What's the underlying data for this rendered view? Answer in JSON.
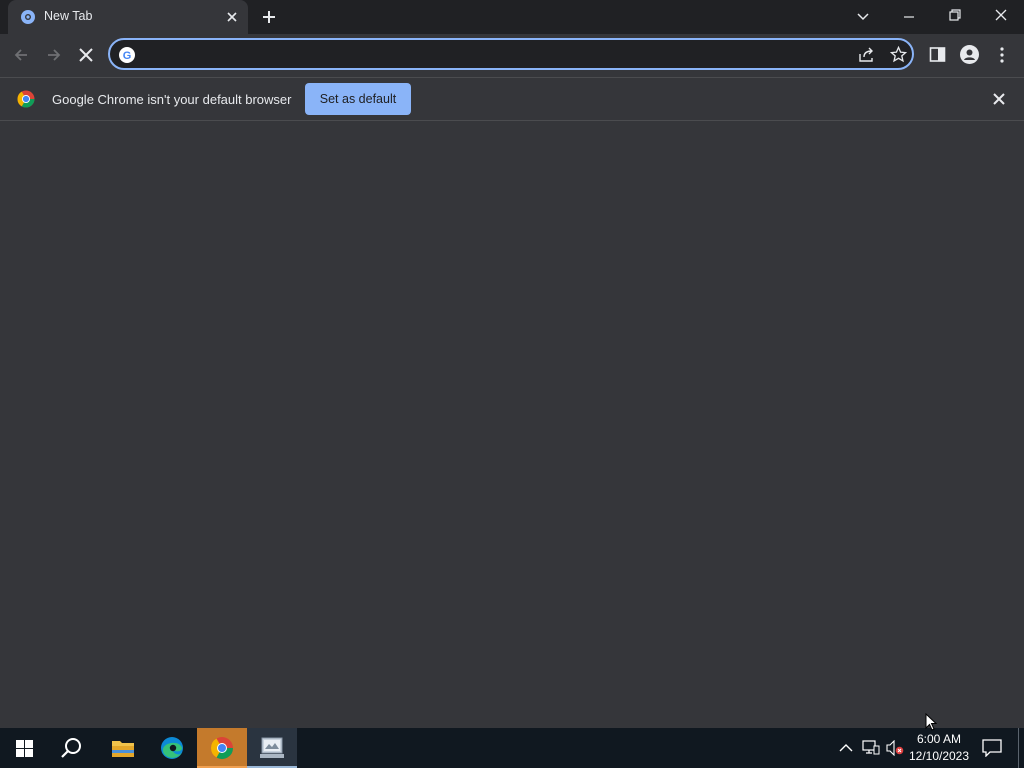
{
  "browser": {
    "tab": {
      "title": "New Tab"
    },
    "omnibox": {
      "value": "",
      "placeholder": ""
    },
    "infobar": {
      "message": "Google Chrome isn't your default browser",
      "button_label": "Set as default"
    }
  },
  "taskbar": {
    "apps": [
      "start-icon",
      "search-icon",
      "file-explorer-icon",
      "edge-icon",
      "chrome-icon",
      "app-icon"
    ],
    "clock": {
      "time": "6:00 AM",
      "date": "12/10/2023"
    }
  },
  "colors": {
    "accent": "#8ab4f8",
    "frame": "#202124",
    "toolbar": "#35363a",
    "taskbar": "#101820"
  }
}
